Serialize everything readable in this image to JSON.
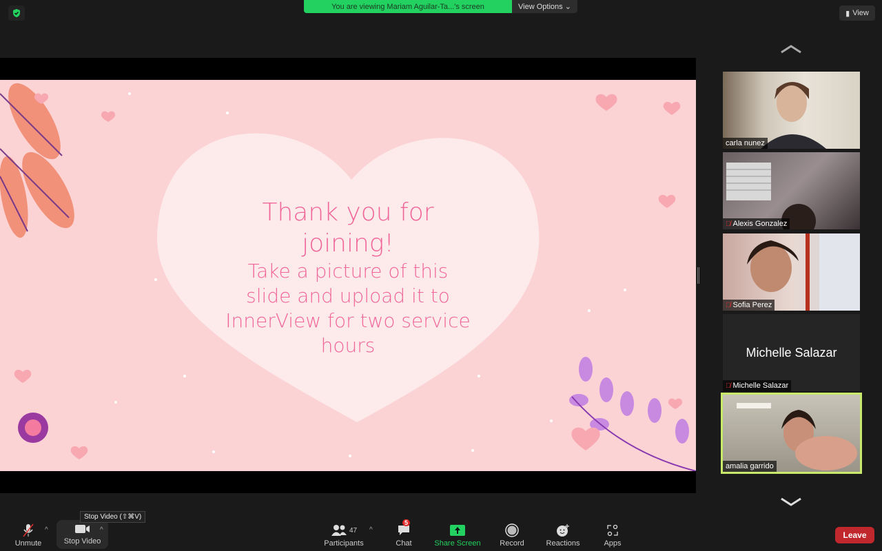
{
  "banner": {
    "text": "You are viewing Mariam Aguilar-Ta...'s screen",
    "view_options": "View Options"
  },
  "view_button": "View",
  "slide": {
    "line1": "Thank you for",
    "line2": "joining!",
    "line3": "Take a picture of this",
    "line4": "slide and upload it to",
    "line5": "InnerView for two service",
    "line6": "hours"
  },
  "participants": [
    {
      "name": "carla nunez",
      "muted": false
    },
    {
      "name": "Alexis Gonzalez",
      "muted": true
    },
    {
      "name": "Sofia Perez",
      "muted": true
    },
    {
      "name": "Michelle Salazar",
      "muted": true,
      "video_off_label": "Michelle Salazar"
    },
    {
      "name": "amalia garrido",
      "muted": false,
      "active_speaker": true
    }
  ],
  "toolbar": {
    "unmute": "Unmute",
    "stop_video": "Stop Video",
    "participants": "Participants",
    "participant_count": "47",
    "chat": "Chat",
    "chat_badge": "5",
    "share_screen": "Share Screen",
    "record": "Record",
    "reactions": "Reactions",
    "apps": "Apps",
    "leave": "Leave"
  },
  "tooltip": "Stop Video (⇧⌘V)",
  "colors": {
    "share_green": "#23d160",
    "leave_red": "#c0282d",
    "slide_pink": "#fcd3d5",
    "slide_text": "#f0669a",
    "active_border": "#c9e96a"
  }
}
